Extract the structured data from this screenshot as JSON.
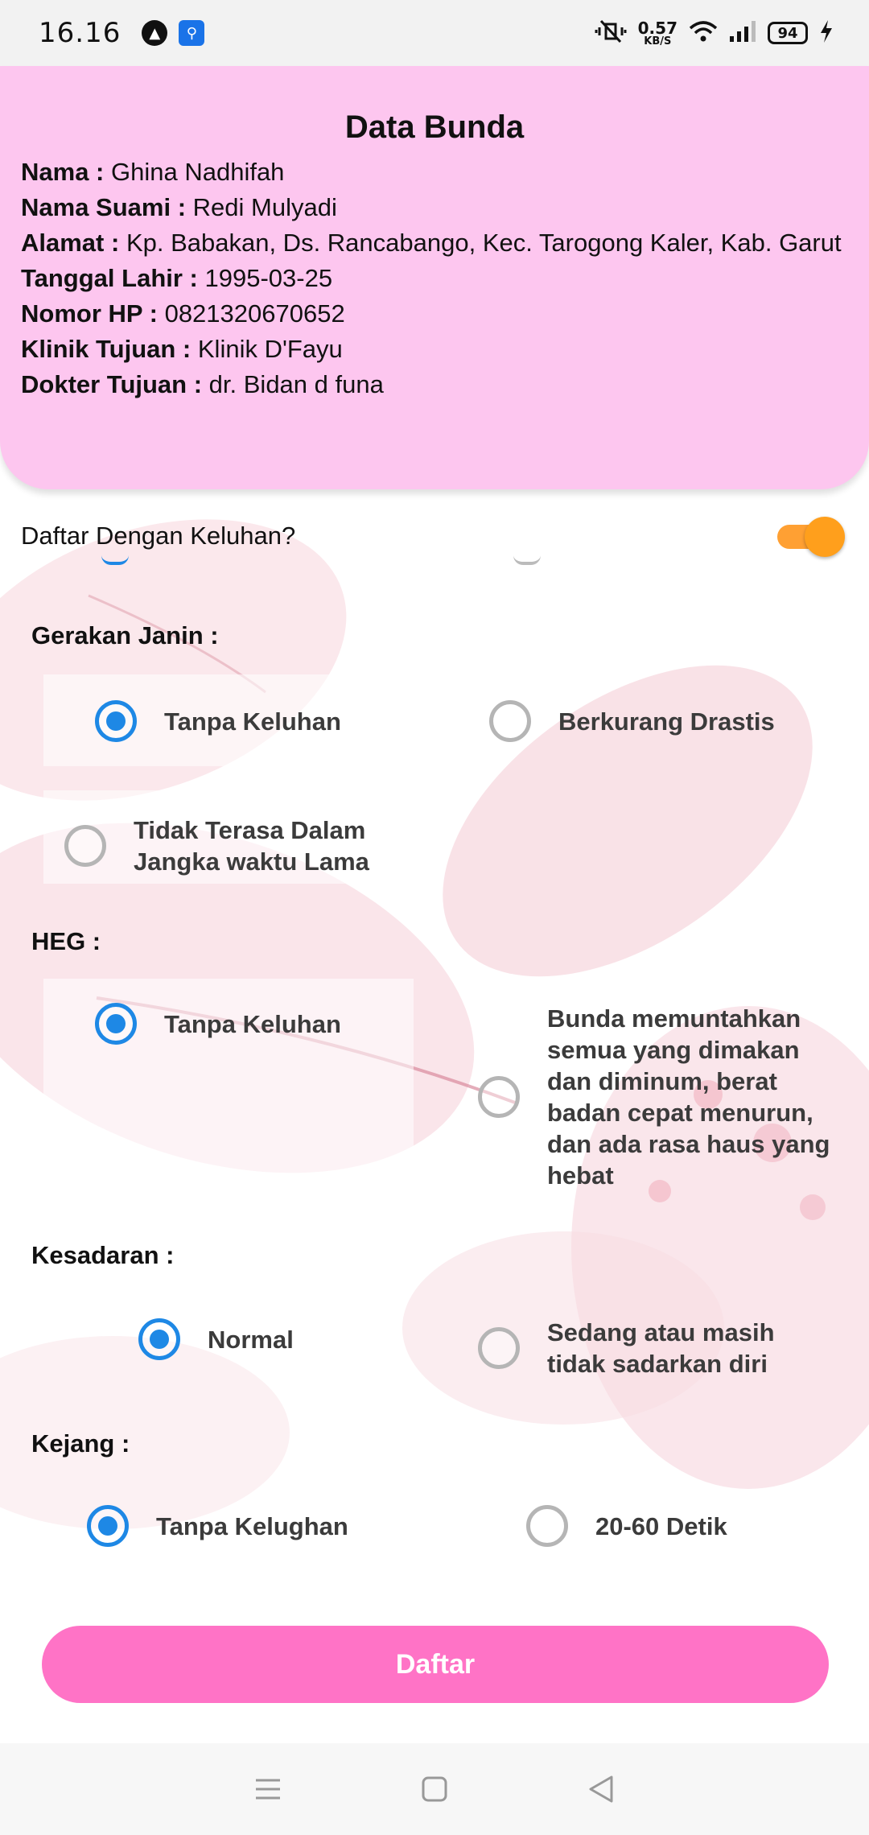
{
  "status_bar": {
    "time": "16.16",
    "net_speed_value": "0.57",
    "net_speed_unit": "KB/S",
    "battery": "94"
  },
  "header": {
    "title": "Data Bunda",
    "fields": [
      {
        "label": "Nama :",
        "value": "Ghina Nadhifah"
      },
      {
        "label": "Nama Suami :",
        "value": "Redi Mulyadi"
      },
      {
        "label": "Alamat :",
        "value": "Kp. Babakan, Ds. Rancabango, Kec. Tarogong Kaler, Kab. Garut"
      },
      {
        "label": "Tanggal Lahir :",
        "value": "1995-03-25"
      },
      {
        "label": "Nomor HP :",
        "value": "0821320670652"
      },
      {
        "label": "Klinik Tujuan :",
        "value": "Klinik D'Fayu"
      },
      {
        "label": "Dokter Tujuan :",
        "value": "dr. Bidan d funa"
      }
    ]
  },
  "toggle": {
    "label": "Daftar Dengan Keluhan?",
    "on": true,
    "color": "#ff9f1c"
  },
  "sections": {
    "gerakan_janin": {
      "label": "Gerakan Janin :",
      "options": [
        "Tanpa Keluhan",
        "Berkurang Drastis",
        "Tidak Terasa Dalam Jangka waktu Lama"
      ],
      "selected": "Tanpa Keluhan"
    },
    "heg": {
      "label": "HEG :",
      "options": [
        "Tanpa Keluhan",
        "Bunda memuntahkan semua yang dimakan dan diminum, berat badan cepat menurun, dan ada rasa haus yang hebat"
      ],
      "selected": "Tanpa Keluhan"
    },
    "kesadaran": {
      "label": "Kesadaran :",
      "options": [
        "Normal",
        "Sedang atau masih tidak sadarkan diri"
      ],
      "selected": "Normal"
    },
    "kejang": {
      "label": "Kejang :",
      "options": [
        "Tanpa Kelughan",
        "20-60 Detik"
      ],
      "selected": "Tanpa Kelughan"
    }
  },
  "submit": {
    "label": "Daftar",
    "color": "#ff73c6"
  },
  "colors": {
    "header_bg": "#fdc6ef",
    "radio_checked": "#1e88e5",
    "radio_unchecked": "#b5b5b5"
  }
}
